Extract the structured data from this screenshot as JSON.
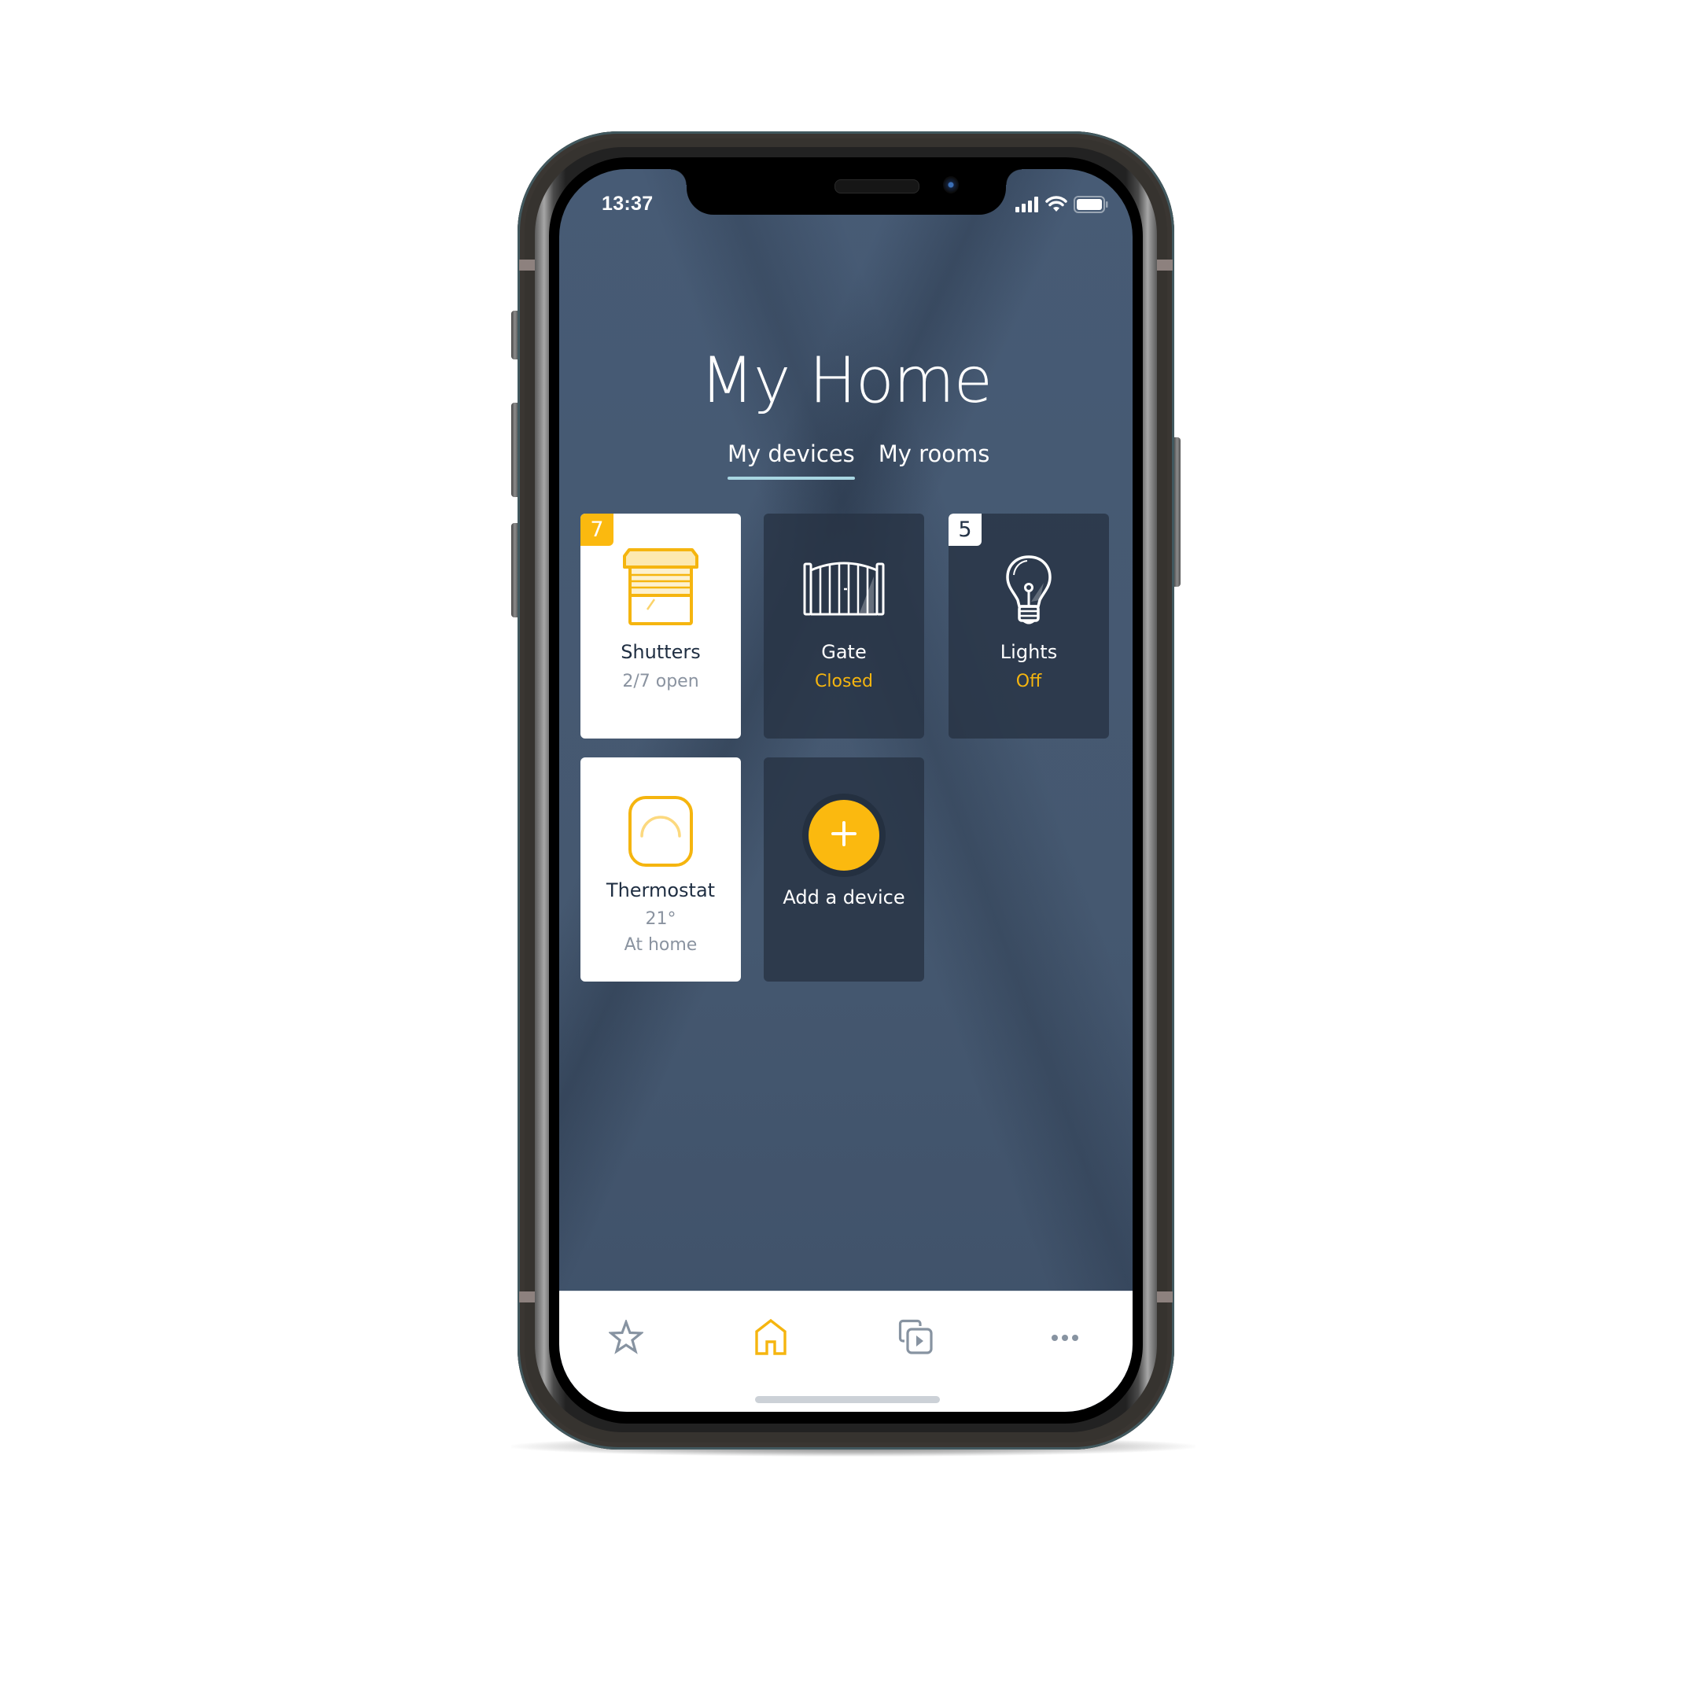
{
  "status_bar": {
    "time": "13:37",
    "icons": [
      "cellular-signal-icon",
      "wifi-icon",
      "battery-icon"
    ]
  },
  "header": {
    "title": "My Home"
  },
  "tabs": [
    {
      "label": "My devices",
      "active": true
    },
    {
      "label": "My rooms",
      "active": false
    }
  ],
  "devices": [
    {
      "name": "Shutters",
      "status": "2/7 open",
      "badge": "7",
      "icon": "shutter-icon",
      "style": "light"
    },
    {
      "name": "Gate",
      "status": "Closed",
      "badge": null,
      "icon": "gate-icon",
      "style": "dark"
    },
    {
      "name": "Lights",
      "status": "Off",
      "badge": "5",
      "icon": "light-bulb-icon",
      "style": "dark"
    },
    {
      "name": "Thermostat",
      "status": "21°",
      "status_secondary": "At home",
      "badge": null,
      "icon": "thermostat-icon",
      "style": "light"
    }
  ],
  "add_device": {
    "label": "Add a device",
    "icon": "plus-icon"
  },
  "bottom_nav": [
    {
      "id": "favorites",
      "icon": "star-icon",
      "active": false
    },
    {
      "id": "home",
      "icon": "home-icon",
      "active": true
    },
    {
      "id": "scenarios",
      "icon": "media-play-icon",
      "active": false
    },
    {
      "id": "more",
      "icon": "more-dots-icon",
      "active": false
    }
  ],
  "colors": {
    "accent": "#fbb90f",
    "background": "#475b75",
    "card_dark": "#263242",
    "tab_underline": "#a8d6e2",
    "nav_inactive": "#8793a1"
  }
}
